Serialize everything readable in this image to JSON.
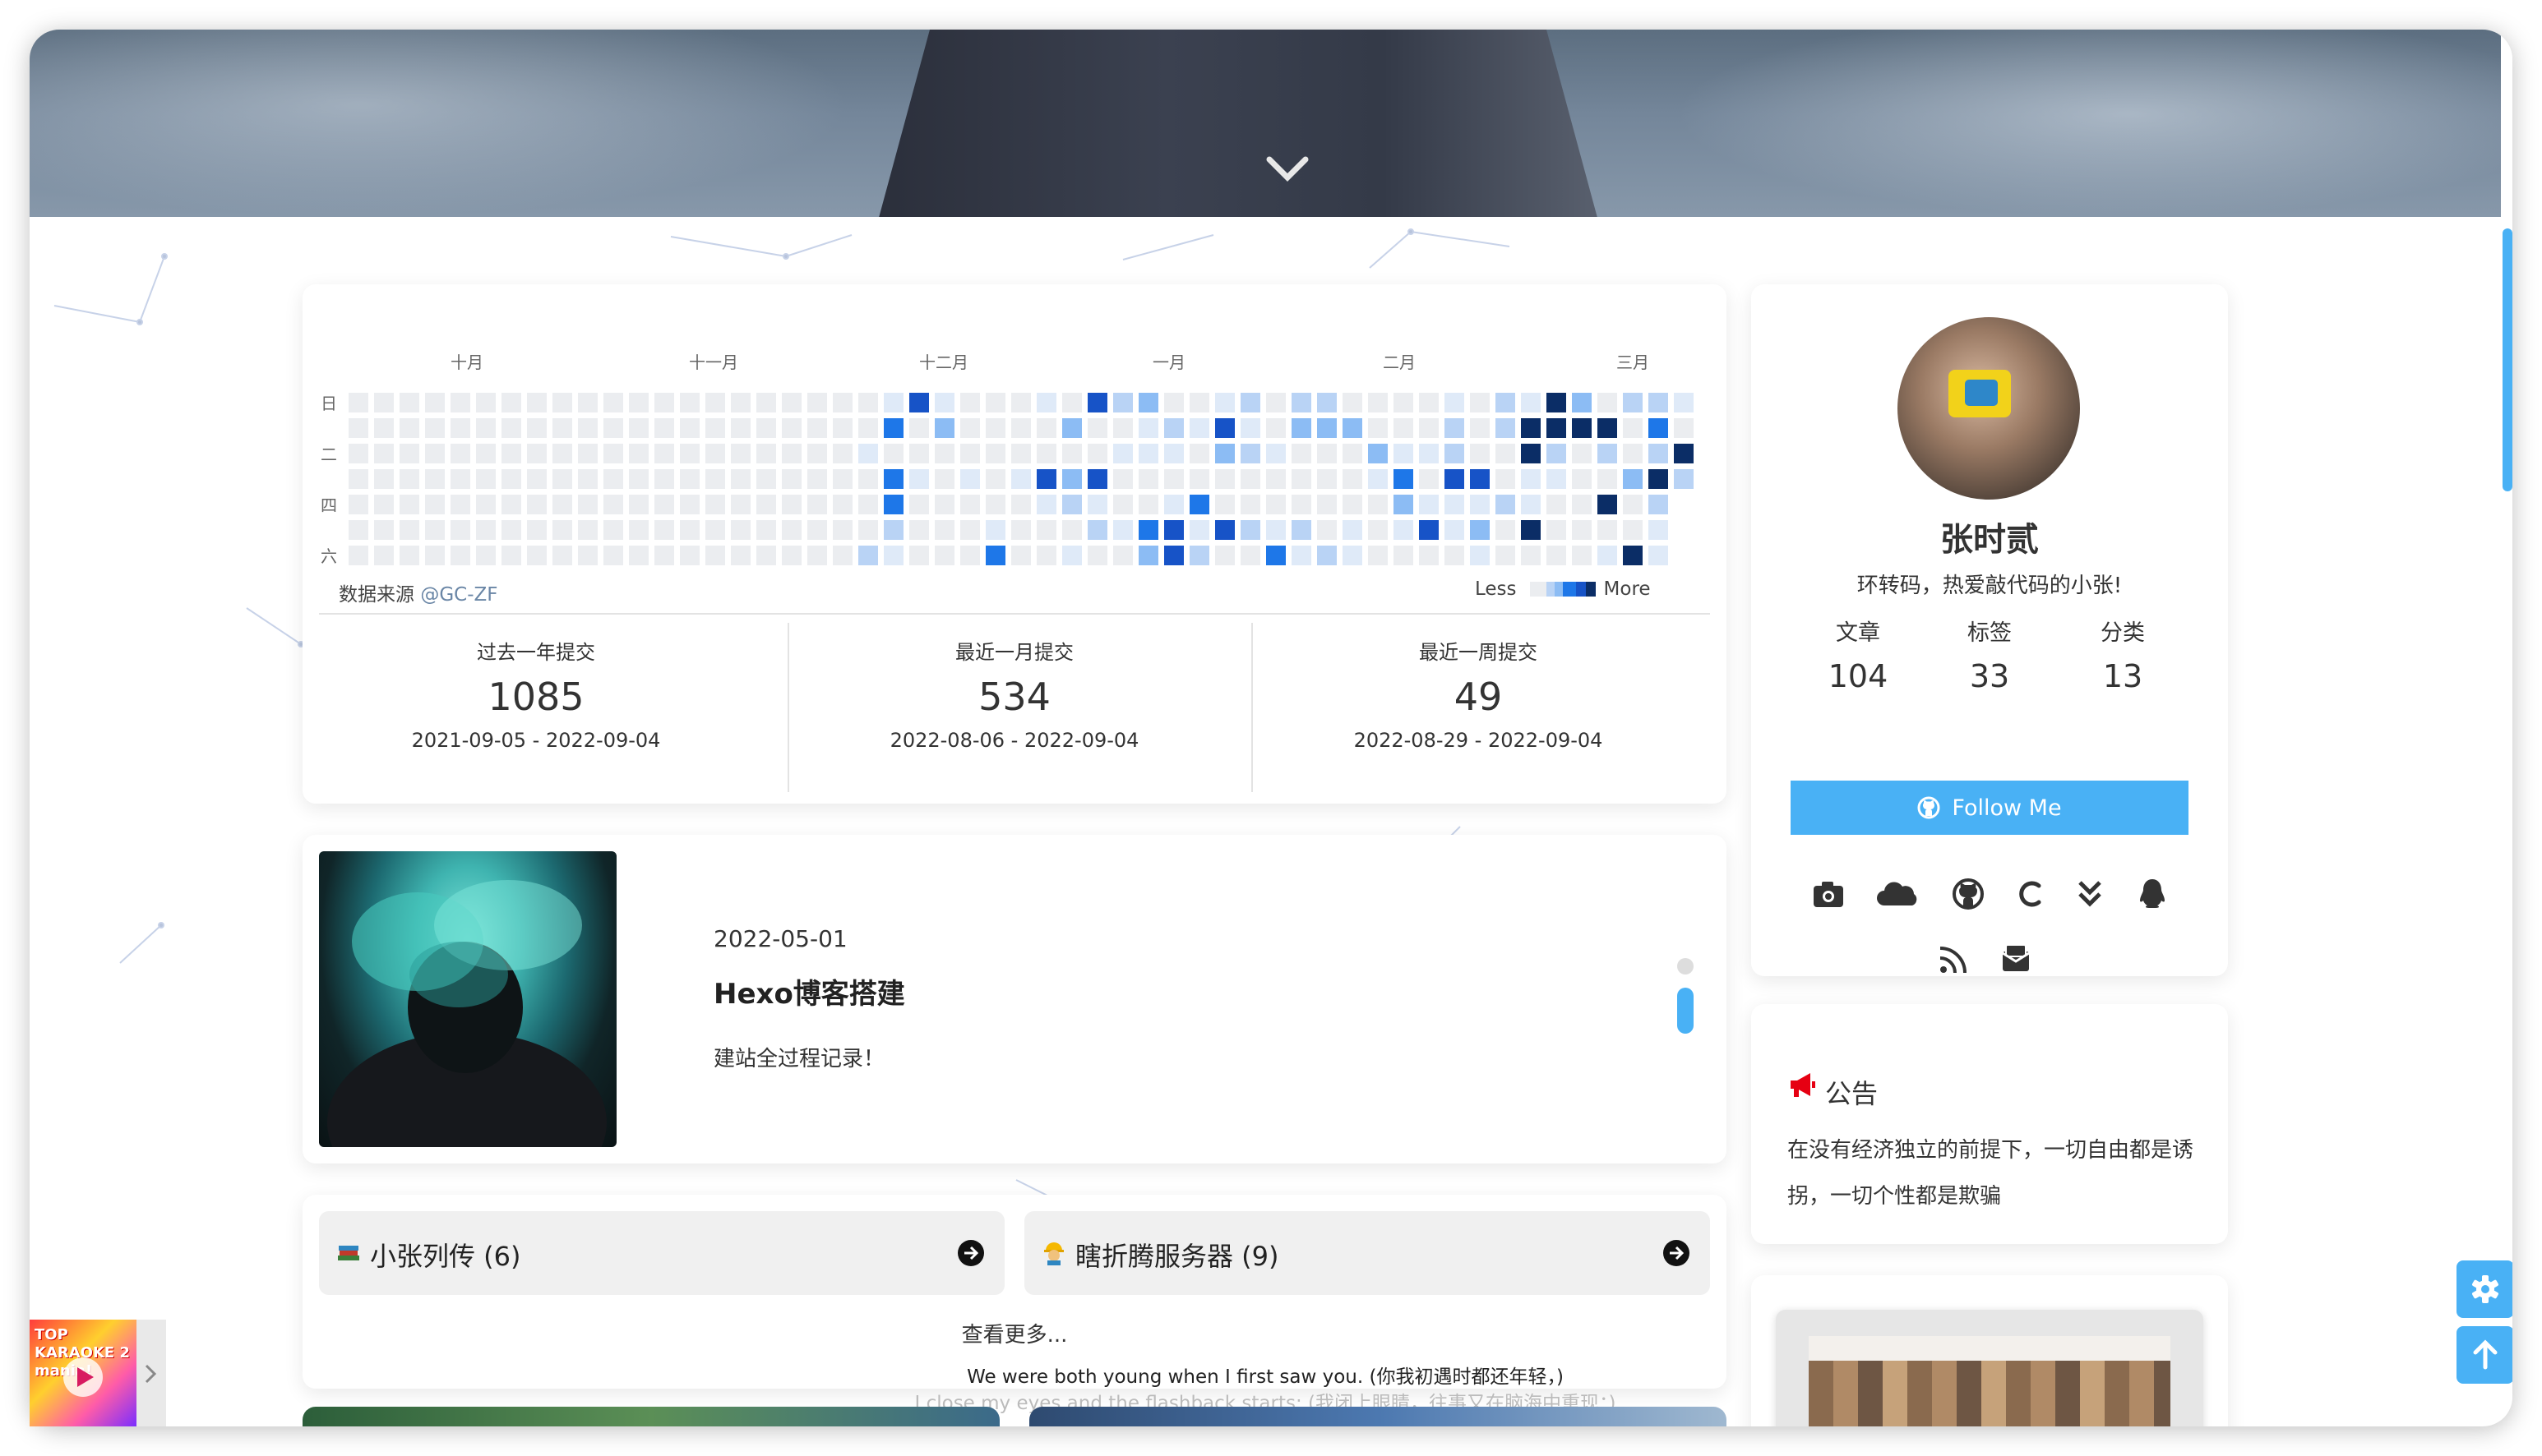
{
  "calendar": {
    "months": [
      "十月",
      "十一月",
      "十二月",
      "一月",
      "二月",
      "三月"
    ],
    "weekdays": [
      "日",
      "二",
      "四",
      "六"
    ],
    "source_label": "数据来源 ",
    "source_user": "@GC-ZF",
    "legend_less": "Less",
    "legend_more": "More",
    "colors": [
      "#ebedf0",
      "#dfeaf8",
      "#b9d3f5",
      "#8cbcf4",
      "#1e77e8",
      "#1753c7",
      "#0b2d66"
    ]
  },
  "stats": [
    {
      "title": "过去一年提交",
      "count": "1085",
      "range": "2021-09-05 - 2022-09-04"
    },
    {
      "title": "最近一月提交",
      "count": "534",
      "range": "2022-08-06 - 2022-09-04"
    },
    {
      "title": "最近一周提交",
      "count": "49",
      "range": "2022-08-29 - 2022-09-04"
    }
  ],
  "post": {
    "date": "2022-05-01",
    "title": "Hexo博客搭建",
    "description": "建站全过程记录！"
  },
  "categories": [
    {
      "label": "小张列传 (6)"
    },
    {
      "label": "瞎折腾服务器 (9)"
    }
  ],
  "categories_more": "查看更多...",
  "lyrics": {
    "line1": "We were both young when I first saw you. (你我初遇时都还年轻，)",
    "line2": "I close my eyes and the flashback starts: (我闭上眼睛，往事又在脑海中重现：)"
  },
  "profile": {
    "name": "张时贰",
    "bio": "环转码，热爱敲代码的小张!",
    "stats": [
      {
        "label": "文章",
        "value": "104"
      },
      {
        "label": "标签",
        "value": "33"
      },
      {
        "label": "分类",
        "value": "13"
      }
    ],
    "follow_label": "Follow Me"
  },
  "notice": {
    "title": "公告",
    "text": "在没有经济独立的前提下，一切自由都是诱拐，一切个性都是欺骗"
  },
  "music": {
    "cover_text": "TOP KARAOKE 2 mania!"
  },
  "accent": "#49b1f5"
}
